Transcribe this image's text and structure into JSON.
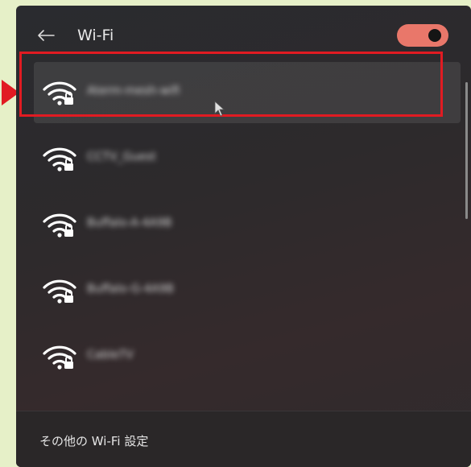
{
  "header": {
    "title": "Wi-Fi",
    "back_icon": "arrow-left-icon",
    "toggle": {
      "state": "on",
      "color": "#e9776a"
    }
  },
  "networks": [
    {
      "ssid": "Aterm-mesh-wifi",
      "icon": "wifi-secured-icon"
    },
    {
      "ssid": "CCTV_Guest",
      "icon": "wifi-secured-icon"
    },
    {
      "ssid": "Buffalo-A-4A9B",
      "icon": "wifi-secured-icon"
    },
    {
      "ssid": "Buffalo-G-4A9B",
      "icon": "wifi-secured-icon"
    },
    {
      "ssid": "CableTV",
      "icon": "wifi-secured-icon"
    }
  ],
  "footer": {
    "more_settings_label": "その他の Wi-Fi 設定"
  },
  "annotation": {
    "highlight_color": "#e11b22"
  }
}
